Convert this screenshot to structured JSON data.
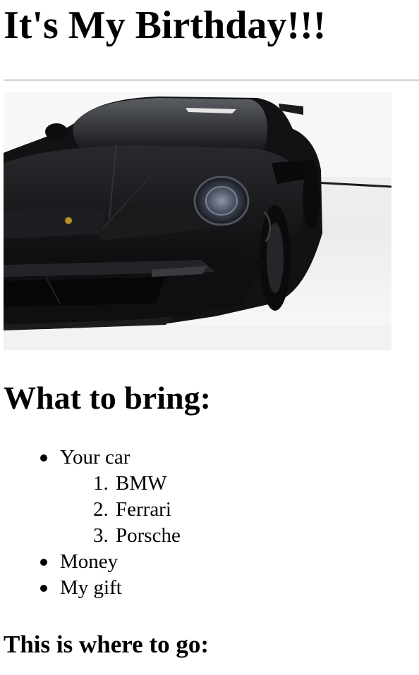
{
  "page": {
    "title": "It's My Birthday!!!",
    "image_alt": "Black Porsche 911 sports car",
    "what_to_bring_heading": "What to bring:",
    "bring_list": [
      {
        "label": "Your car",
        "sub_items": [
          "BMW",
          "Ferrari",
          "Porsche"
        ]
      },
      {
        "label": "Money"
      },
      {
        "label": "My gift"
      }
    ],
    "sub_numbers": [
      "1.",
      "2.",
      "3."
    ],
    "where_heading": "This is where to go:"
  },
  "colors": {
    "car_body": "#141416",
    "background": "#ffffff",
    "studio_wall": "#f3f3f3"
  },
  "icons": {
    "bullet": "disc-bullet-icon"
  }
}
